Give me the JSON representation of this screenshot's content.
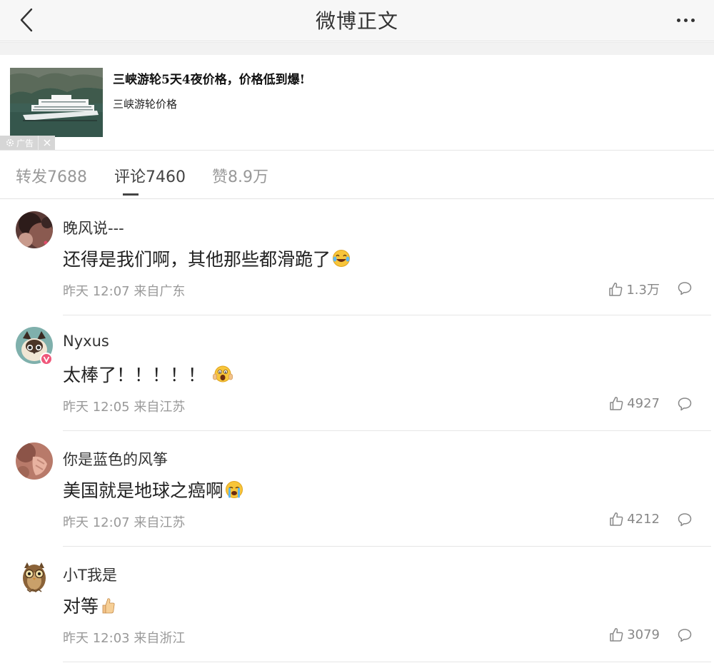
{
  "header": {
    "title": "微博正文"
  },
  "ad": {
    "title": "三峡游轮5天4夜价格，价格低到爆!",
    "subtitle": "三峡游轮价格",
    "tag": "广告"
  },
  "tabs": [
    {
      "label": "转发7688"
    },
    {
      "label": "评论7460"
    },
    {
      "label": "赞8.9万"
    }
  ],
  "comments": [
    {
      "user": "晚风说---",
      "text": "还得是我们啊，其他那些都滑跪了",
      "emoji": "laughing-tears-emoji",
      "meta": "昨天 12:07 来自广东",
      "likes": "1.3万"
    },
    {
      "user": "Nyxus",
      "text": "太棒了！！！！！",
      "emoji": "screaming-face-emoji",
      "meta": "昨天 12:05 来自江苏",
      "likes": "4927"
    },
    {
      "user": "你是蓝色的风筝",
      "text": "美国就是地球之癌啊",
      "emoji": "crying-face-emoji",
      "meta": "昨天 12:07 来自江苏",
      "likes": "4212"
    },
    {
      "user": "小T我是",
      "text": "对等",
      "emoji": "thumbs-up-emoji",
      "meta": "昨天 12:03 来自浙江",
      "likes": "3079"
    }
  ],
  "colors": {
    "text": "#333333",
    "muted": "#999999",
    "divider": "#e6e6e6",
    "badge": "#f0577a"
  }
}
